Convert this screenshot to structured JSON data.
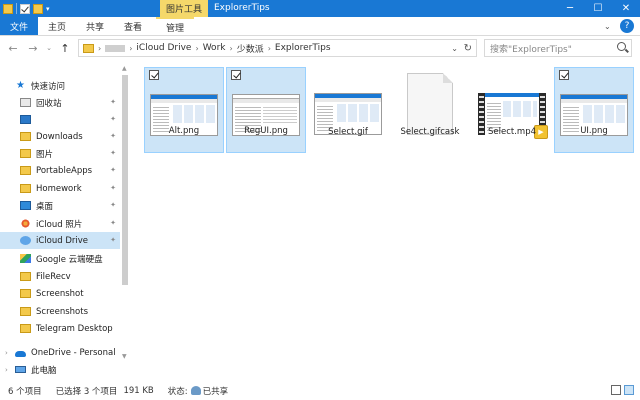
{
  "titlebar": {
    "context_tab": "图片工具",
    "title": "ExplorerTips",
    "minimize": "─",
    "maximize": "☐",
    "close": "✕"
  },
  "ribbon": {
    "tabs": [
      "文件",
      "主页",
      "共享",
      "查看",
      "管理"
    ],
    "help": "?"
  },
  "address": {
    "crumbs": [
      "iCloud Drive",
      "Work",
      "少数派",
      "ExplorerTips"
    ],
    "search_placeholder": "搜索\"ExplorerTips\""
  },
  "nav": {
    "items": [
      {
        "label": "快速访问",
        "icon": "star-icon",
        "pinned": false
      },
      {
        "label": "回收站",
        "icon": "recycle-bin-icon",
        "pinned": true
      },
      {
        "label": "",
        "icon": "app-icon",
        "pinned": true
      },
      {
        "label": "Downloads",
        "icon": "folder-icon",
        "pinned": true
      },
      {
        "label": "图片",
        "icon": "folder-icon",
        "pinned": true
      },
      {
        "label": "PortableApps",
        "icon": "folder-icon",
        "pinned": true
      },
      {
        "label": "Homework",
        "icon": "folder-icon",
        "pinned": true
      },
      {
        "label": "桌面",
        "icon": "desktop-icon",
        "pinned": true
      },
      {
        "label": "iCloud 照片",
        "icon": "photos-icon",
        "pinned": true
      },
      {
        "label": "iCloud Drive",
        "icon": "icloud-icon",
        "pinned": true
      },
      {
        "label": "Google 云端硬盘",
        "icon": "google-drive-icon",
        "pinned": false
      },
      {
        "label": "FileRecv",
        "icon": "folder-icon",
        "pinned": false
      },
      {
        "label": "Screenshot",
        "icon": "folder-icon",
        "pinned": false
      },
      {
        "label": "Screenshots",
        "icon": "folder-icon",
        "pinned": false
      },
      {
        "label": "Telegram Desktop",
        "icon": "folder-icon",
        "pinned": false
      },
      {
        "label": "OneDrive - Personal",
        "icon": "onedrive-icon",
        "pinned": false
      },
      {
        "label": "此电脑",
        "icon": "pc-icon",
        "pinned": false
      }
    ]
  },
  "files": [
    {
      "name": "Alt.png",
      "selected": true
    },
    {
      "name": "RegUI.png",
      "selected": true
    },
    {
      "name": "Select.gif",
      "selected": false
    },
    {
      "name": "Select.gifcask",
      "selected": false
    },
    {
      "name": "Select.mp4",
      "selected": false
    },
    {
      "name": "UI.png",
      "selected": true
    }
  ],
  "status": {
    "count": "6 个项目",
    "selected": "已选择 3 个项目",
    "size": "191 KB",
    "state_label": "状态:",
    "state_value": "已共享"
  }
}
